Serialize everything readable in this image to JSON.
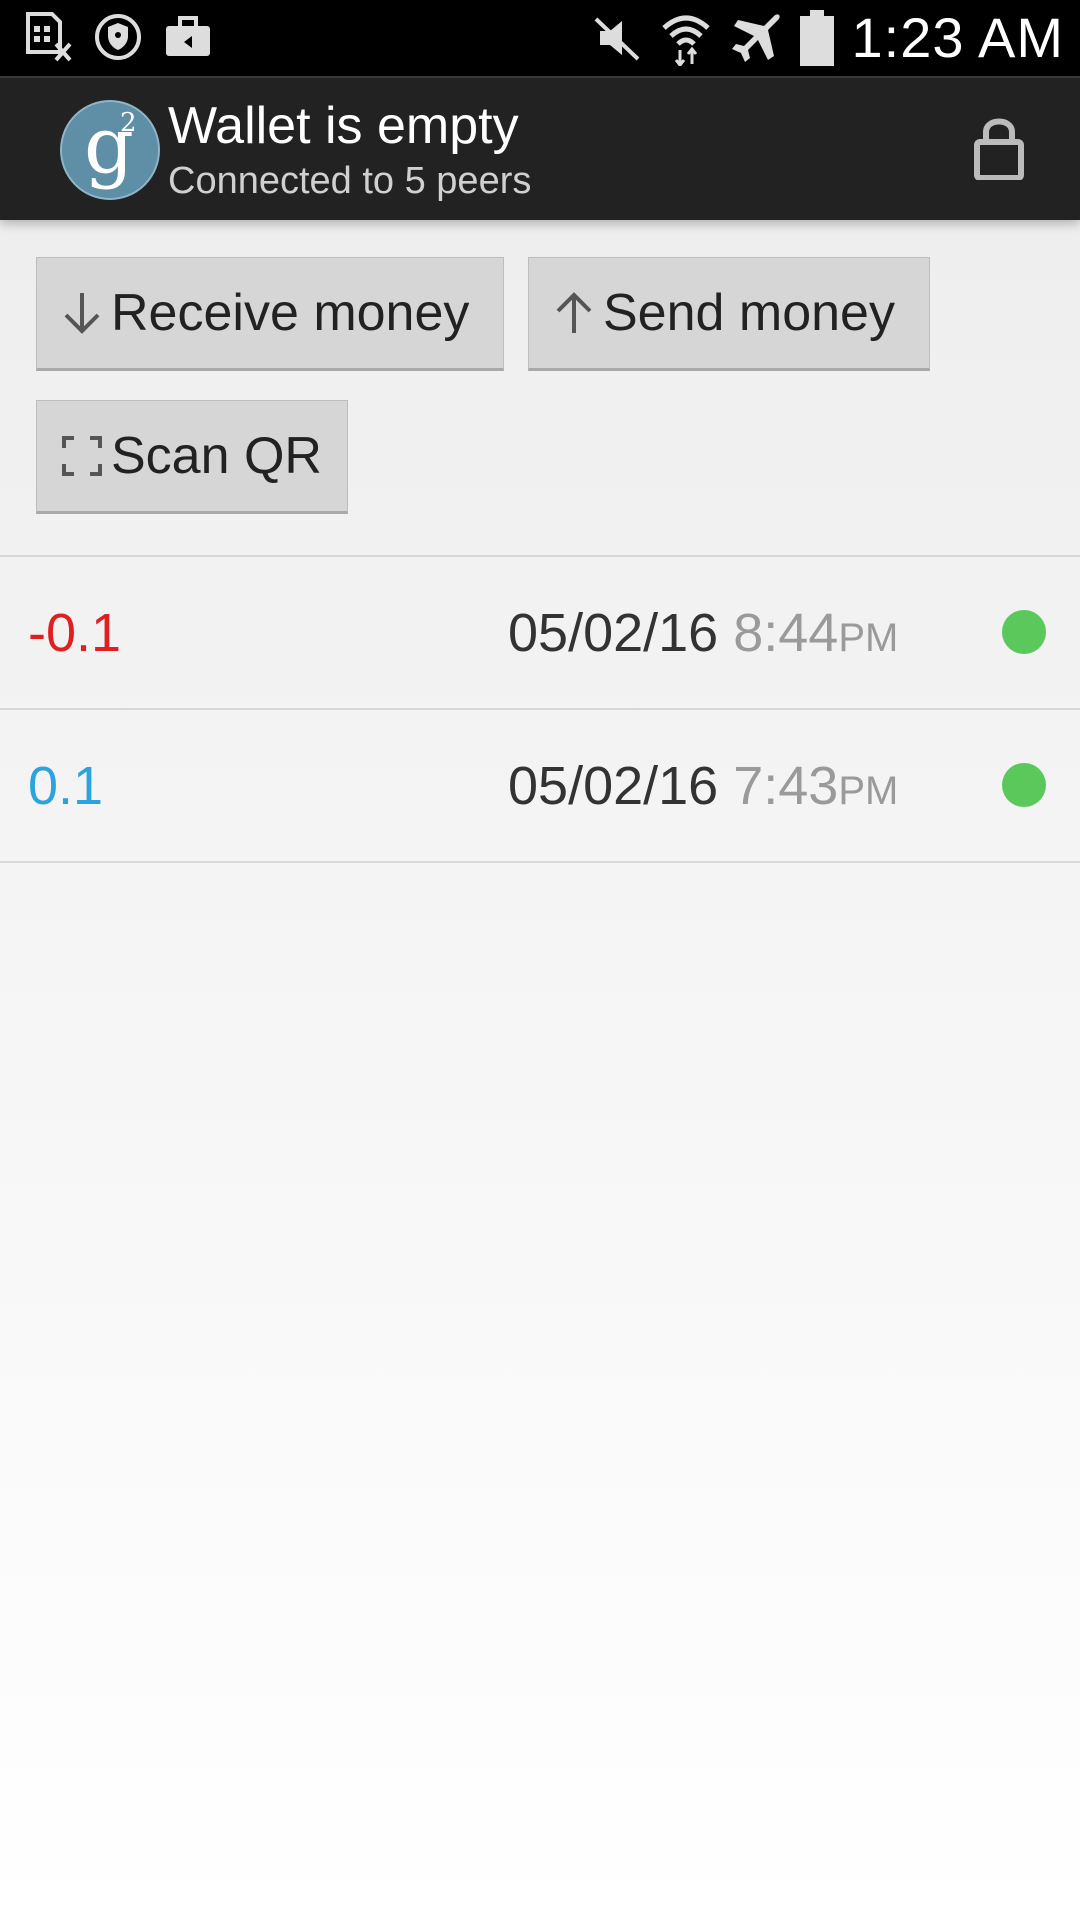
{
  "status_bar": {
    "time": "1:23 AM",
    "left_icons": [
      "sim-error-icon",
      "shield-icon",
      "briefcase-icon"
    ],
    "right_icons": [
      "mute-icon",
      "wifi-icon",
      "airplane-icon",
      "battery-icon"
    ]
  },
  "action_bar": {
    "title": "Wallet is empty",
    "subtitle": "Connected to 5 peers",
    "logo_letter": "g",
    "logo_superscript": "2",
    "lock_icon": "lock-icon"
  },
  "buttons": {
    "receive": "Receive money",
    "send": "Send money",
    "scan": "Scan QR"
  },
  "transactions": [
    {
      "amount": "-0.1",
      "amount_color": "#e02020",
      "date": "05/02/16",
      "time": "8:44",
      "ampm": "PM",
      "status_color": "#5bc85b"
    },
    {
      "amount": "0.1",
      "amount_color": "#2ca3dc",
      "date": "05/02/16",
      "time": "7:43",
      "ampm": "PM",
      "status_color": "#5bc85b"
    }
  ]
}
